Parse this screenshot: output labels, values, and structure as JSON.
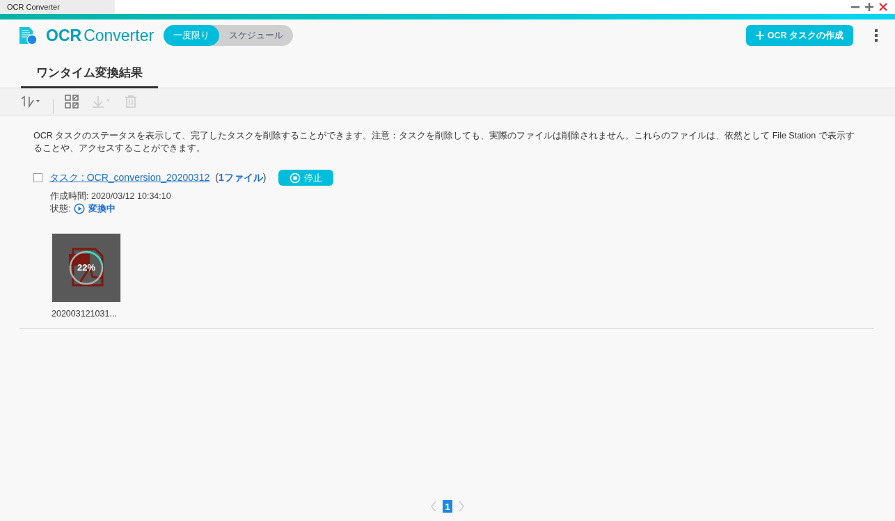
{
  "browser_tab": {
    "title": "OCR Converter"
  },
  "app": {
    "title_bold": "OCR",
    "title_light": "Converter"
  },
  "mode_switch": [
    {
      "label": "一度限り",
      "selected": true
    },
    {
      "label": "スケジュール",
      "selected": false
    }
  ],
  "create_button": {
    "label": "OCR タスクの作成"
  },
  "tabs": [
    {
      "label": "ワンタイム変換結果",
      "selected": true
    }
  ],
  "toolbar": [
    {
      "kind": "sort",
      "disabled": false
    },
    {
      "kind": "select",
      "disabled": false
    },
    {
      "kind": "download",
      "disabled": true
    },
    {
      "kind": "delete",
      "disabled": true
    }
  ],
  "description": "OCR タスクのステータスを表示して、完了したタスクを削除することができます。注意：タスクを削除しても、実際のファイルは削除されません。これらのファイルは、依然として File Station で表示することや、アクセスすることができます。",
  "tasks": [
    {
      "checked": false,
      "name": "タスク : OCR_conversion_20200312",
      "count_open": "(",
      "count": "1ファイル",
      "count_close": ")",
      "stop_button": "停止",
      "created_label": "作成時間:",
      "created": "2020/03/12 10:34:10",
      "status_label": "状態:",
      "status": "変換中",
      "files": [
        {
          "progress": "22%",
          "level": 0.22,
          "name": "202003121031..."
        }
      ]
    }
  ],
  "pagination": {
    "pages": [
      {
        "label": "1",
        "selected": true
      }
    ]
  }
}
